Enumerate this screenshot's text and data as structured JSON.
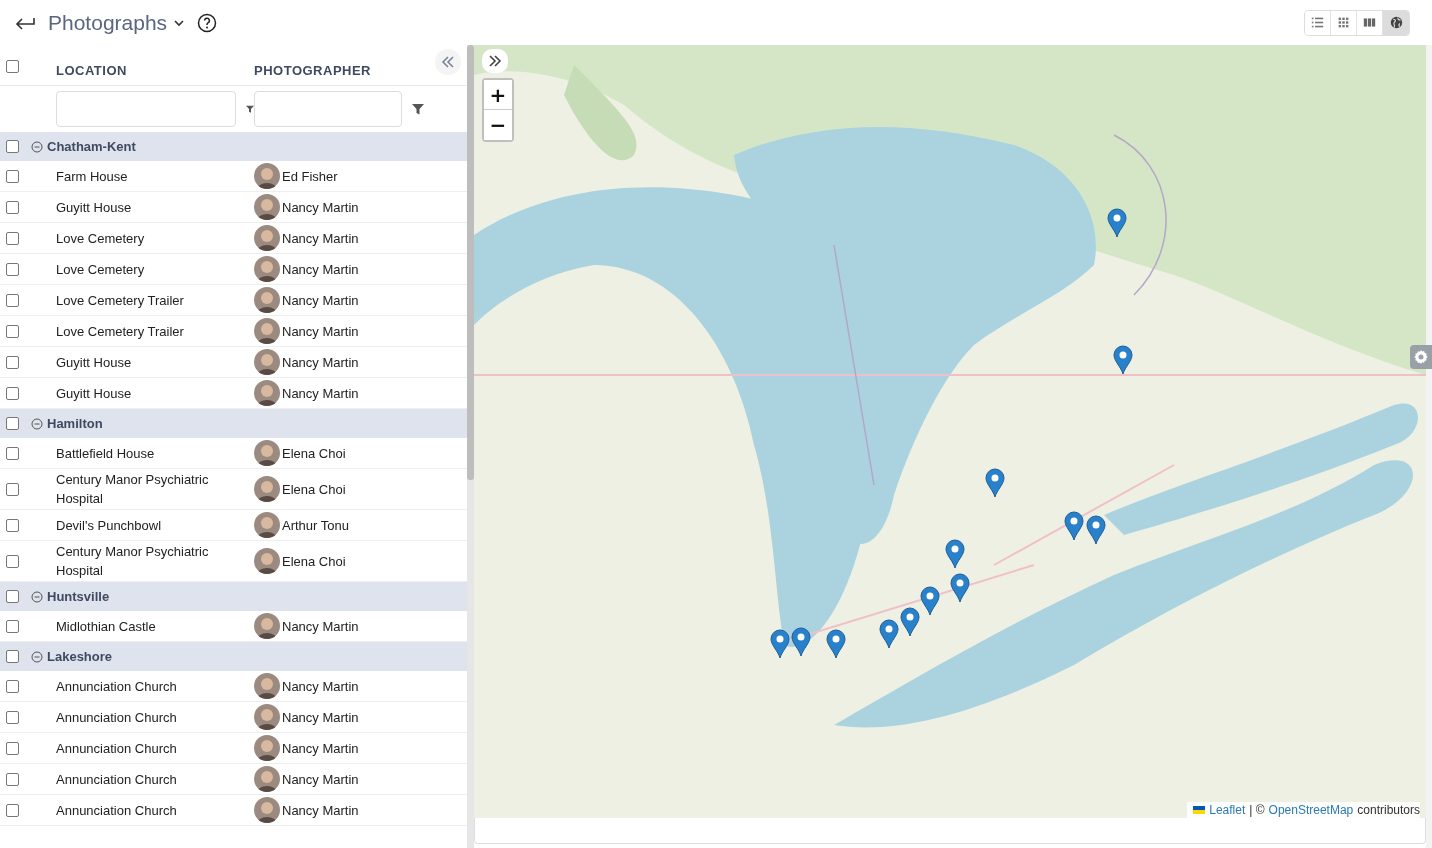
{
  "header": {
    "title": "Photographs"
  },
  "view_buttons": [
    {
      "kind": "list",
      "selected": false
    },
    {
      "kind": "grid",
      "selected": false
    },
    {
      "kind": "columns",
      "selected": false
    },
    {
      "kind": "map",
      "selected": true
    }
  ],
  "table": {
    "select_all_checked": false,
    "columns": [
      "LOCATION",
      "PHOTOGRAPHER"
    ],
    "groups": [
      {
        "name": "Chatham-Kent",
        "expanded": true,
        "checked": false,
        "rows": [
          {
            "location": "Farm House",
            "photographer": "Ed Fisher",
            "checked": false
          },
          {
            "location": "Guyitt House",
            "photographer": "Nancy Martin",
            "checked": false
          },
          {
            "location": "Love Cemetery",
            "photographer": "Nancy Martin",
            "checked": false
          },
          {
            "location": "Love Cemetery",
            "photographer": "Nancy Martin",
            "checked": false
          },
          {
            "location": "Love Cemetery Trailer",
            "photographer": "Nancy Martin",
            "checked": false
          },
          {
            "location": "Love Cemetery Trailer",
            "photographer": "Nancy Martin",
            "checked": false
          },
          {
            "location": "Guyitt House",
            "photographer": "Nancy Martin",
            "checked": false
          },
          {
            "location": "Guyitt House",
            "photographer": "Nancy Martin",
            "checked": false
          }
        ]
      },
      {
        "name": "Hamilton",
        "expanded": true,
        "checked": false,
        "rows": [
          {
            "location": "Battlefield House",
            "photographer": "Elena Choi",
            "checked": false
          },
          {
            "location": "Century Manor Psychiatric Hospital",
            "photographer": "Elena Choi",
            "checked": false
          },
          {
            "location": "Devil's Punchbowl",
            "photographer": "Arthur Tonu",
            "checked": false
          },
          {
            "location": "Century Manor Psychiatric Hospital",
            "photographer": "Elena Choi",
            "checked": false
          }
        ]
      },
      {
        "name": "Huntsville",
        "expanded": true,
        "checked": false,
        "rows": [
          {
            "location": "Midlothian Castle",
            "photographer": "Nancy Martin",
            "checked": false
          }
        ]
      },
      {
        "name": "Lakeshore",
        "expanded": true,
        "checked": false,
        "rows": [
          {
            "location": "Annunciation Church",
            "photographer": "Nancy Martin",
            "checked": false
          },
          {
            "location": "Annunciation Church",
            "photographer": "Nancy Martin",
            "checked": false
          },
          {
            "location": "Annunciation Church",
            "photographer": "Nancy Martin",
            "checked": false
          },
          {
            "location": "Annunciation Church",
            "photographer": "Nancy Martin",
            "checked": false
          },
          {
            "location": "Annunciation Church",
            "photographer": "Nancy Martin",
            "checked": false
          }
        ]
      }
    ]
  },
  "map": {
    "kind": "picture",
    "zoom_in": "+",
    "zoom_out": "−",
    "attribution": {
      "link_1": "Leaflet",
      "separator": "| ©",
      "link_2": "OpenStreetMap",
      "suffix": "contributors"
    }
  }
}
